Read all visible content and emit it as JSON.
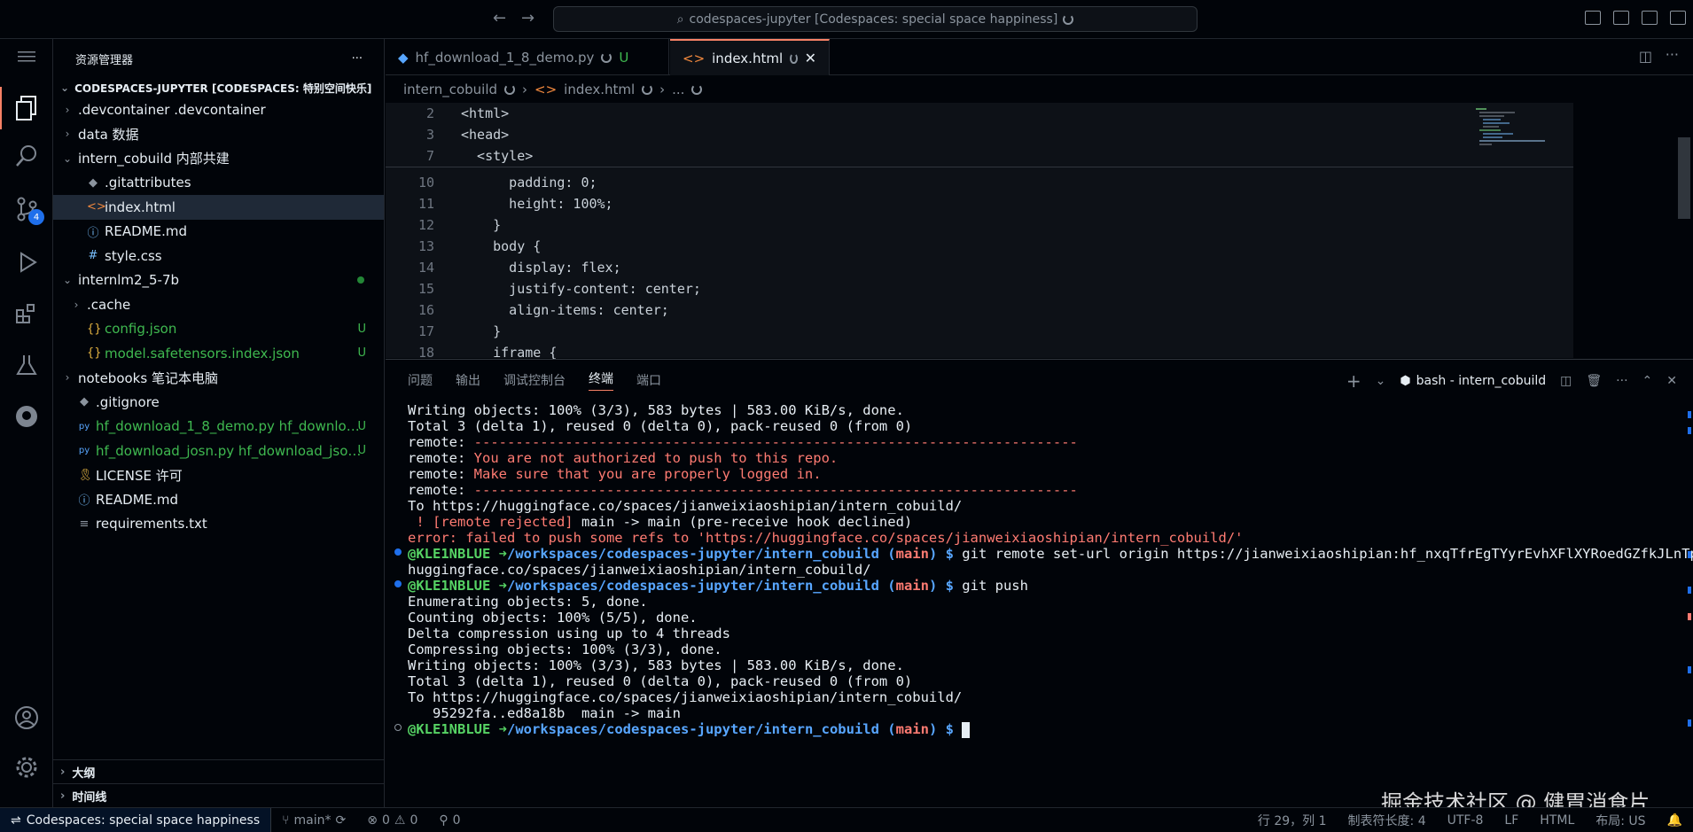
{
  "window": {
    "title": "codespaces-jupyter [Codespaces: special space happiness]"
  },
  "sidebar": {
    "header": "资源管理器",
    "more": "···",
    "root": "CODESPACES-JUPYTER [CODESPACES: 特别空间快乐]",
    "items": [
      {
        "label": ".devcontainer .devcontainer",
        "indent": 1,
        "chev": "›",
        "icon": "",
        "status": ""
      },
      {
        "label": "data 数据",
        "indent": 1,
        "chev": "›",
        "icon": "",
        "status": ""
      },
      {
        "label": "intern_cobuild 内部共建",
        "indent": 1,
        "chev": "⌄",
        "icon": "",
        "status": ""
      },
      {
        "label": ".gitattributes",
        "indent": 2,
        "chev": "",
        "icon": "◆",
        "status": ""
      },
      {
        "label": "index.html",
        "indent": 2,
        "chev": "",
        "icon": "<>",
        "status": ""
      },
      {
        "label": "README.md",
        "indent": 2,
        "chev": "",
        "icon": "ⓘ",
        "status": ""
      },
      {
        "label": "style.css",
        "indent": 2,
        "chev": "",
        "icon": "#",
        "status": ""
      },
      {
        "label": "internlm2_5-7b",
        "indent": 1,
        "chev": "⌄",
        "icon": "",
        "status": "dot"
      },
      {
        "label": ".cache",
        "indent": 2,
        "chev": "›",
        "icon": "",
        "status": ""
      },
      {
        "label": "config.json",
        "indent": 2,
        "chev": "",
        "icon": "{}",
        "status": "U"
      },
      {
        "label": "model.safetensors.index.json",
        "indent": 2,
        "chev": "",
        "icon": "{}",
        "status": "U"
      },
      {
        "label": "notebooks 笔记本电脑",
        "indent": 1,
        "chev": "›",
        "icon": "",
        "status": ""
      },
      {
        "label": ".gitignore",
        "indent": 1,
        "chev": "",
        "icon": "◆",
        "status": ""
      },
      {
        "label": "hf_download_1_8_demo.py hf_downloa...",
        "indent": 1,
        "chev": "",
        "icon": "py",
        "status": "U"
      },
      {
        "label": "hf_download_josn.py hf_download_json...",
        "indent": 1,
        "chev": "",
        "icon": "py",
        "status": "U"
      },
      {
        "label": "LICENSE 许可",
        "indent": 1,
        "chev": "",
        "icon": "🎗",
        "status": ""
      },
      {
        "label": "README.md",
        "indent": 1,
        "chev": "",
        "icon": "ⓘ",
        "status": ""
      },
      {
        "label": "requirements.txt",
        "indent": 1,
        "chev": "",
        "icon": "≡",
        "status": ""
      }
    ],
    "footer": {
      "outline": "大纲",
      "timeline": "时间线"
    }
  },
  "tabs": [
    {
      "label": "hf_download_1_8_demo.py",
      "status": "U",
      "active": false
    },
    {
      "label": "index.html",
      "status": "",
      "active": true
    }
  ],
  "breadcrumb": {
    "folder": "intern_cobuild",
    "file": "index.html",
    "more": "..."
  },
  "code": {
    "lines": [
      {
        "n": "2",
        "text": "<html>"
      },
      {
        "n": "3",
        "text": "<head>"
      },
      {
        "n": "7",
        "text": "  <style>"
      },
      {
        "n": "10",
        "text": "      padding: 0;"
      },
      {
        "n": "11",
        "text": "      height: 100%;"
      },
      {
        "n": "12",
        "text": "    }"
      },
      {
        "n": "13",
        "text": "    body {"
      },
      {
        "n": "14",
        "text": "      display: flex;"
      },
      {
        "n": "15",
        "text": "      justify-content: center;"
      },
      {
        "n": "16",
        "text": "      align-items: center;"
      },
      {
        "n": "17",
        "text": "    }"
      },
      {
        "n": "18",
        "text": "    iframe {"
      }
    ]
  },
  "panel": {
    "tabs": [
      "问题",
      "输出",
      "调试控制台",
      "终端",
      "端口"
    ],
    "active_tab": "终端",
    "terminal_name": "bash - intern_cobuild",
    "plus": "+",
    "terminal": {
      "user": "@KLE1NBLUE",
      "arrow": "➜",
      "path": "/workspaces/codespaces-jupyter/intern_cobuild",
      "branch_open": " (",
      "branch": "main",
      "branch_close": ") $ ",
      "lines": [
        "Writing objects: 100% (3/3), 583 bytes | 583.00 KiB/s, done.",
        "Total 3 (delta 1), reused 0 (delta 0), pack-reused 0 (from 0)",
        "remote: ",
        "-------------------------------------------------------------------------",
        "You are not authorized to push to this repo.",
        "Make sure that you are properly logged in.",
        "To https://huggingface.co/spaces/jianweixiaoshipian/intern_cobuild/",
        " ! ",
        "[remote rejected]",
        " main -> main (pre-receive hook declined)",
        "error: failed to push some refs to 'https://huggingface.co/spaces/jianweixiaoshipian/intern_cobuild/'",
        "git remote set-url origin https://jianweixiaoshipian: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@",
        "huggingface.co/spaces/jianweixiaoshipian/intern_cobuild/",
        "git push",
        "Enumerating objects: 5, done.",
        "Counting objects: 100% (5/5), done.",
        "Delta compression using up to 4 threads",
        "Compressing objects: 100% (3/3), done.",
        "Writing objects: 100% (3/3), 583 bytes | 583.00 KiB/s, done.",
        "Total 3 (delta 1), reused 0 (delta 0), pack-reused 0 (from 0)",
        "To https://huggingface.co/spaces/jianweixiaoshipian/intern_cobuild/",
        "   95292fa..ed8a18b  main -> main"
      ]
    }
  },
  "watermark": "掘金技术社区 @ 健胃消食片_",
  "statusbar": {
    "remote": "Codespaces: special space happiness",
    "branch": "main*",
    "errors": "0",
    "warnings": "0",
    "ports": "0",
    "position": "行 29，列 1",
    "indent": "制表符长度: 4",
    "encoding": "UTF-8",
    "eol": "LF",
    "language": "HTML",
    "layout": "布局: US"
  },
  "colors": {
    "accent": "#f78166",
    "badge": "#1f6feb",
    "untracked": "#3fb950",
    "error": "#ff7b72"
  },
  "activity": {
    "scm_badge": "4"
  }
}
